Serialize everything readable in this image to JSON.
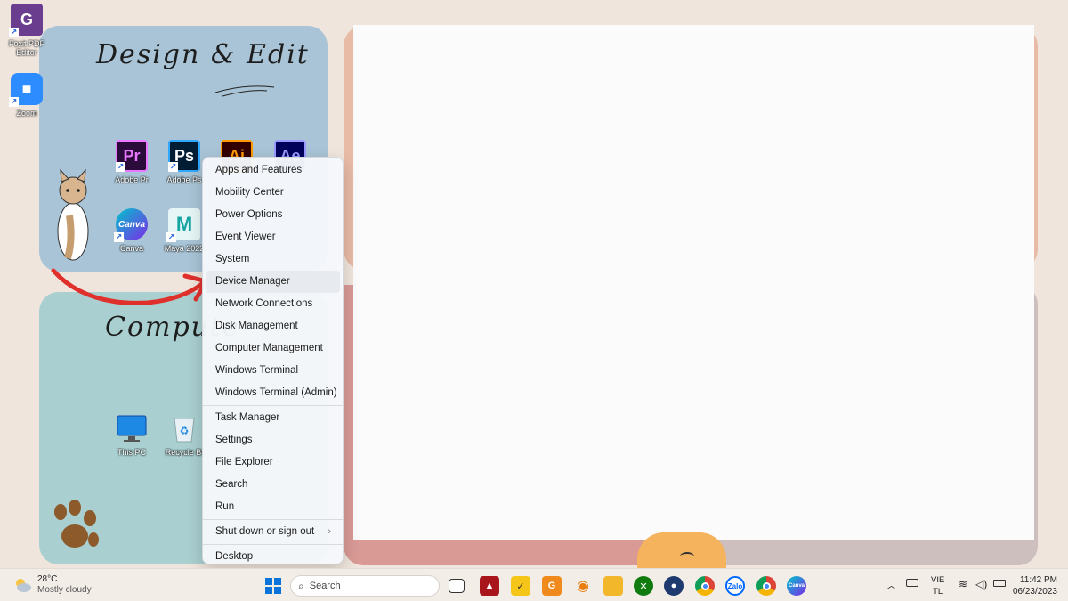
{
  "desktop": {
    "left_icons": [
      {
        "label": "Foxit PDF\nEditor",
        "icon": "foxit-pdf-icon",
        "color": "#6a3d8f"
      },
      {
        "label": "Zoom",
        "icon": "zoom-icon",
        "color": "#2d8cff"
      }
    ],
    "design_title": "Design & Edit",
    "computer_title": "Compute",
    "design_icons": [
      {
        "label": "Adobe Pr",
        "glyph": "Pr",
        "icon": "adobe-premiere-icon",
        "bg": "#2a0b3a",
        "fg": "#ea77ff"
      },
      {
        "label": "Adobe Ps",
        "glyph": "Ps",
        "icon": "adobe-photoshop-icon",
        "bg": "#001d34",
        "fg": "#31a8ff"
      },
      {
        "label": "",
        "glyph": "Ai",
        "icon": "adobe-illustrator-icon",
        "bg": "#330000",
        "fg": "#ff9a00"
      },
      {
        "label": "",
        "glyph": "Ae",
        "icon": "adobe-after-effects-icon",
        "bg": "#00005b",
        "fg": "#9999ff"
      },
      {
        "label": "Canva",
        "glyph": "Canva",
        "icon": "canva-icon",
        "bg": "#7d2ae8",
        "fg": "#ffffff"
      },
      {
        "label": "Maya 2022",
        "glyph": "M",
        "icon": "maya-icon",
        "bg": "#e6f6f6",
        "fg": "#16a4a4"
      }
    ],
    "computer_icons": [
      {
        "label": "This PC",
        "icon": "this-pc-icon"
      },
      {
        "label": "Recycle Bi",
        "icon": "recycle-bin-icon"
      }
    ]
  },
  "context_menu": {
    "group1": [
      "Apps and Features",
      "Mobility Center",
      "Power Options",
      "Event Viewer",
      "System",
      "Device Manager",
      "Network Connections",
      "Disk Management",
      "Computer Management",
      "Windows Terminal",
      "Windows Terminal (Admin)"
    ],
    "group2": [
      "Task Manager",
      "Settings",
      "File Explorer",
      "Search",
      "Run"
    ],
    "shutdown": "Shut down or sign out",
    "desktop": "Desktop",
    "highlighted": "Device Manager"
  },
  "taskbar": {
    "weather_temp": "28°C",
    "weather_desc": "Mostly cloudy",
    "search_placeholder": "Search",
    "apps": [
      {
        "icon": "start-icon",
        "color": "#0a74da"
      },
      {
        "icon": "search-icon",
        "color": "#333333"
      },
      {
        "icon": "task-view-icon",
        "color": "#222222"
      },
      {
        "icon": "app-red-icon",
        "color": "#a8161b"
      },
      {
        "icon": "sticky-notes-icon",
        "color": "#f5c518"
      },
      {
        "icon": "foxit-taskbar-icon",
        "color": "#f08a1c"
      },
      {
        "icon": "blender-icon",
        "color": "#e87d0d"
      },
      {
        "icon": "file-explorer-icon",
        "color": "#f2b72b"
      },
      {
        "icon": "xbox-icon",
        "color": "#107c10"
      },
      {
        "icon": "cinema4d-icon",
        "color": "#1f3a6e"
      },
      {
        "icon": "chrome-icon",
        "color": "#db4437"
      },
      {
        "icon": "zalo-icon",
        "color": "#0068ff"
      },
      {
        "icon": "chrome-profile-icon",
        "color": "#db4437"
      },
      {
        "icon": "canva-taskbar-icon",
        "color": "#7d2ae8"
      }
    ],
    "lang_top": "VIE",
    "lang_bottom": "TL",
    "time": "11:42 PM",
    "date": "06/23/2023"
  }
}
